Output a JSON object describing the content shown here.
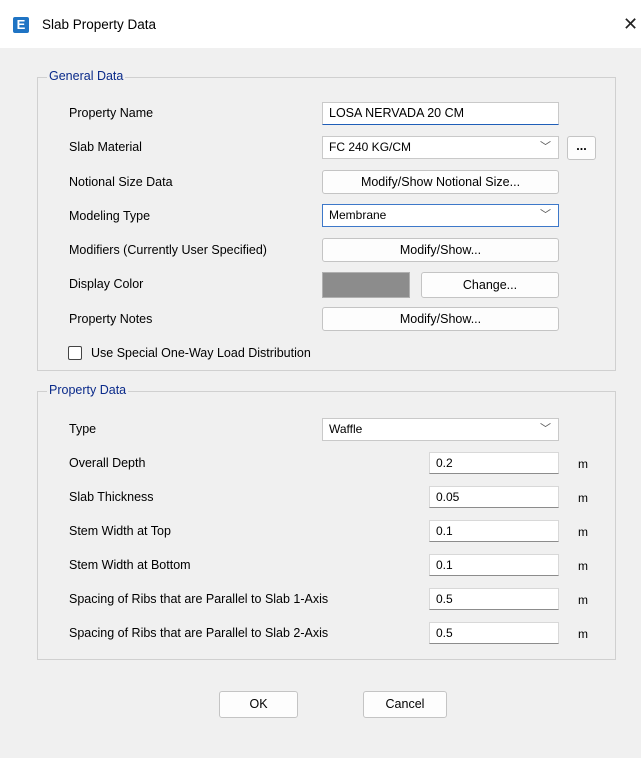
{
  "window": {
    "app_icon": "E",
    "title": "Slab Property Data",
    "close_glyph": "✕"
  },
  "general": {
    "title": "General Data",
    "property_name_label": "Property Name",
    "property_name_value": "LOSA NERVADA 20 CM",
    "slab_material_label": "Slab Material",
    "slab_material_value": "FC 240 KG/CM",
    "ellipsis_label": "...",
    "notional_label": "Notional Size Data",
    "notional_button": "Modify/Show Notional Size...",
    "modeling_label": "Modeling Type",
    "modeling_value": "Membrane",
    "modifiers_label": "Modifiers (Currently User Specified)",
    "modifiers_button": "Modify/Show...",
    "display_color_label": "Display Color",
    "display_color_hex": "#8c8c8c",
    "change_button": "Change...",
    "notes_label": "Property Notes",
    "notes_button": "Modify/Show...",
    "one_way_label": "Use Special One-Way Load Distribution",
    "one_way_checked": false
  },
  "property": {
    "title": "Property Data",
    "type_label": "Type",
    "type_value": "Waffle",
    "rows": [
      {
        "label": "Overall Depth",
        "value": "0.2",
        "unit": "m"
      },
      {
        "label": "Slab Thickness",
        "value": "0.05",
        "unit": "m"
      },
      {
        "label": "Stem Width at Top",
        "value": "0.1",
        "unit": "m"
      },
      {
        "label": "Stem Width at Bottom",
        "value": "0.1",
        "unit": "m"
      },
      {
        "label": "Spacing of Ribs that are Parallel to Slab 1-Axis",
        "value": "0.5",
        "unit": "m"
      },
      {
        "label": "Spacing of Ribs that are Parallel to Slab 2-Axis",
        "value": "0.5",
        "unit": "m"
      }
    ]
  },
  "footer": {
    "ok": "OK",
    "cancel": "Cancel"
  },
  "colors": {
    "group_title": "#0a2a8a",
    "accent": "#1f5eb8",
    "icon": "#1f74c4"
  },
  "icons": {
    "app": "etabs-app-icon",
    "close": "close-icon",
    "dropdown": "chevron-down-icon"
  }
}
